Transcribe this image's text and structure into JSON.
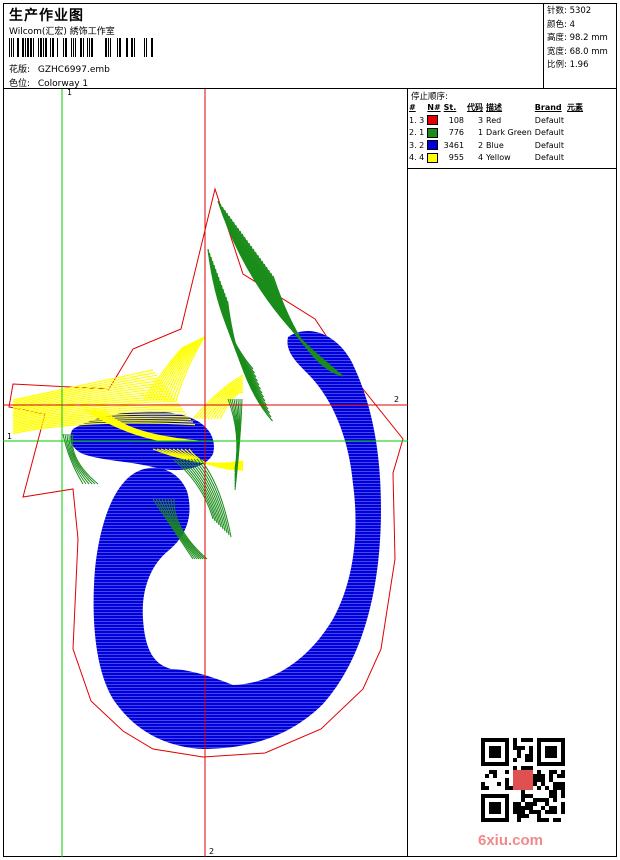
{
  "header": {
    "title": "生产作业图",
    "company": "Wilcom(汇宏) 綉饰工作室",
    "design_label": "花版:",
    "design_value": "GZHC6997.emb",
    "colorway_label": "色位:",
    "colorway_value": "Colorway 1"
  },
  "stats": [
    {
      "label": "针数",
      "value": "5302"
    },
    {
      "label": "颜色",
      "value": "4"
    },
    {
      "label": "高度",
      "value": "98.2 mm"
    },
    {
      "label": "宽度",
      "value": "68.0 mm"
    },
    {
      "label": "比例",
      "value": "1.96"
    }
  ],
  "stop_sequence": {
    "title": "停止顺序:",
    "columns": [
      "#",
      "N#",
      "St.",
      "代码",
      "描述",
      "Brand",
      "元素"
    ],
    "rows": [
      {
        "idx": "1. 3",
        "color": "#e00000",
        "stitches": "108",
        "code": "3",
        "desc": "Red",
        "brand": "Default"
      },
      {
        "idx": "2. 1",
        "color": "#1a8c1a",
        "stitches": "776",
        "code": "1",
        "desc": "Dark Green",
        "brand": "Default"
      },
      {
        "idx": "3. 2",
        "color": "#0000dd",
        "stitches": "3461",
        "code": "2",
        "desc": "Blue",
        "brand": "Default"
      },
      {
        "idx": "4. 4",
        "color": "#ffff00",
        "stitches": "955",
        "code": "4",
        "desc": "Yellow",
        "brand": "Default"
      }
    ]
  },
  "guides": {
    "v1": "1",
    "h1": "1",
    "v2": "2",
    "h2": "2"
  },
  "watermark": "6xiu.com",
  "colors": {
    "red": "#e00000",
    "green": "#1a8c1a",
    "blue": "#0000dd",
    "yellow": "#ffff00",
    "guide_green": "#00cc00",
    "guide_red": "#dd0000"
  }
}
